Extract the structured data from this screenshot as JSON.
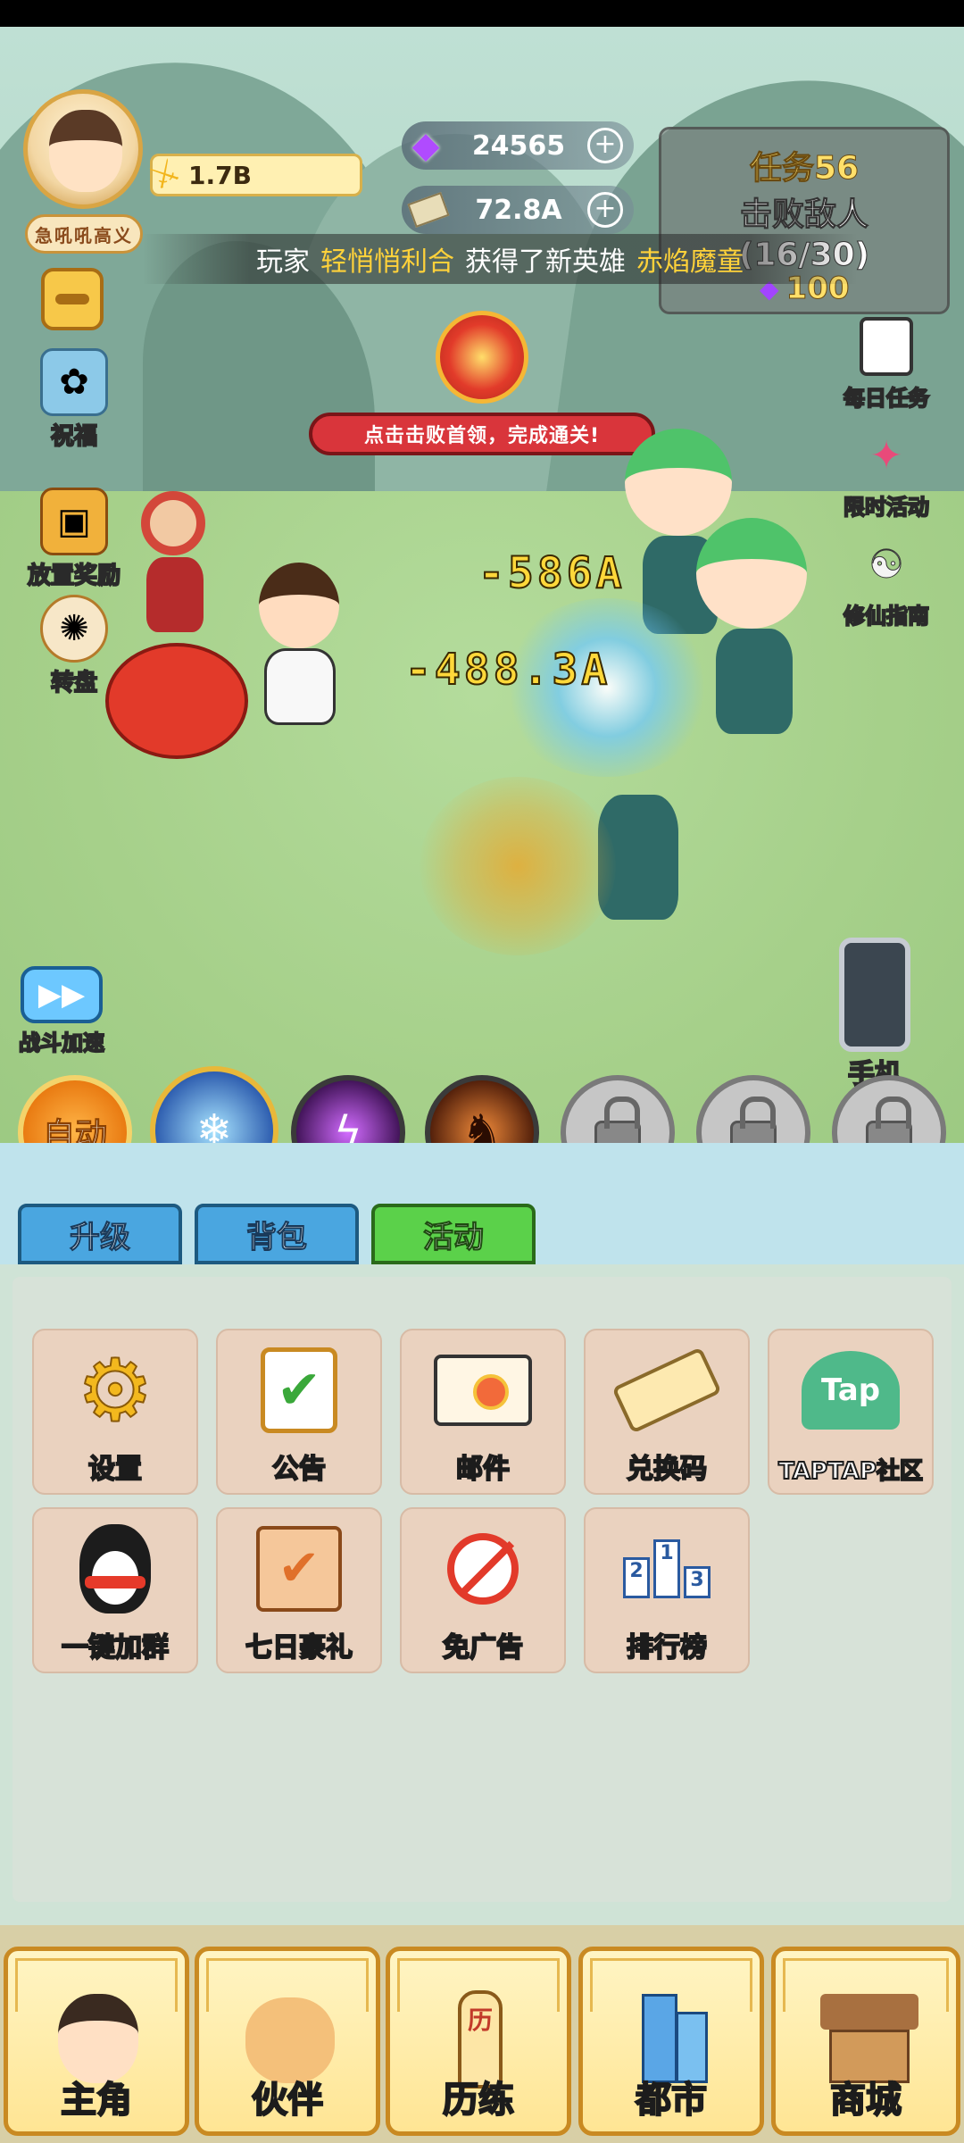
{
  "player": {
    "nickname": "急吼吼高义",
    "power": "1.7B"
  },
  "currency": {
    "gems": "24565",
    "cash": "72.8A"
  },
  "quest": {
    "title": "任务56",
    "description": "击败敌人",
    "progress": "(16/30)",
    "reward": "100"
  },
  "broadcast": {
    "prefix": "玩家",
    "player_name": "轻悄悄利合",
    "middle": "获得了新英雄",
    "hero_name": "赤焰魔童"
  },
  "left_menu": [
    {
      "label": "祝福",
      "icon": "blessing-icon"
    },
    {
      "label": "放置奖励",
      "icon": "idle-reward-chest-icon"
    },
    {
      "label": "转盘",
      "icon": "wheel-icon"
    }
  ],
  "right_menu": [
    {
      "label": "每日任务",
      "icon": "daily-task-icon"
    },
    {
      "label": "限时活动",
      "icon": "limited-event-icon"
    },
    {
      "label": "修仙指南",
      "icon": "cultivation-guide-icon"
    }
  ],
  "boss": {
    "banner": "点击击败首领，完成通关!"
  },
  "damage": [
    "-586A",
    "-488.3A"
  ],
  "battle_speed_label": "战斗加速",
  "phone_label": "手机",
  "skills": {
    "auto_label": "自动"
  },
  "tabs": [
    "升级",
    "背包",
    "活动"
  ],
  "activities": [
    {
      "label": "设置",
      "icon": "gear-icon"
    },
    {
      "label": "公告",
      "icon": "notice-clipboard-icon"
    },
    {
      "label": "邮件",
      "icon": "mail-envelope-icon"
    },
    {
      "label": "兑换码",
      "icon": "ticket-icon"
    },
    {
      "label": "TAPTAP社区",
      "icon": "taptap-icon",
      "badge": "Tap"
    },
    {
      "label": "一键加群",
      "icon": "qq-penguin-icon"
    },
    {
      "label": "七日豪礼",
      "icon": "scroll-checklist-icon"
    },
    {
      "label": "免广告",
      "icon": "no-ads-icon"
    },
    {
      "label": "排行榜",
      "icon": "leaderboard-icon"
    }
  ],
  "bottom_nav": [
    {
      "label": "主角",
      "icon": "hero-avatar-icon"
    },
    {
      "label": "伙伴",
      "icon": "cat-partner-icon"
    },
    {
      "label": "历练",
      "icon": "training-sign-icon",
      "sign_text": "历"
    },
    {
      "label": "都市",
      "icon": "city-buildings-icon"
    },
    {
      "label": "商城",
      "icon": "shop-stall-icon"
    }
  ],
  "colors": {
    "accent_gold": "#f7c849",
    "tab_active": "#5bd14a",
    "tab_inactive": "#4aa6e0",
    "banner_red": "#d9353b",
    "damage_yellow": "#ffd83a"
  }
}
